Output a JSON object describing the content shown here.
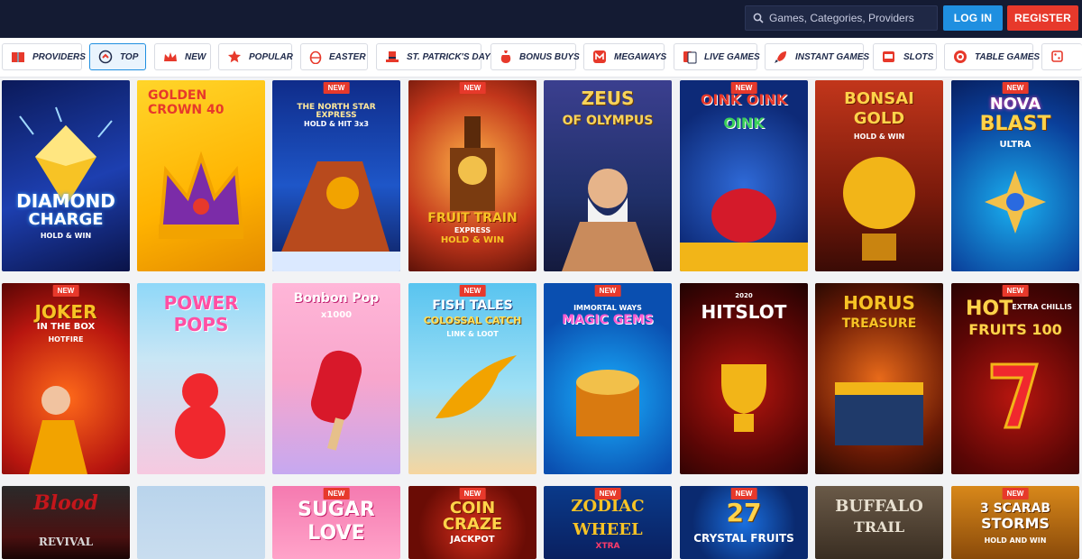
{
  "header": {
    "search_placeholder": "Games, Categories, Providers",
    "login_label": "LOG IN",
    "register_label": "REGISTER"
  },
  "categories": [
    {
      "label": "PROVIDERS",
      "icon": "book-icon"
    },
    {
      "label": "TOP",
      "icon": "top-arrow-icon",
      "active": true
    },
    {
      "label": "NEW",
      "icon": "crown-icon"
    },
    {
      "label": "POPULAR",
      "icon": "star-badge-icon"
    },
    {
      "label": "EASTER",
      "icon": "easter-egg-icon"
    },
    {
      "label": "ST. PATRICK'S DAY",
      "icon": "leprechaun-hat-icon"
    },
    {
      "label": "BONUS BUYS",
      "icon": "money-bag-icon"
    },
    {
      "label": "MEGAWAYS",
      "icon": "megaways-icon"
    },
    {
      "label": "LIVE GAMES",
      "icon": "playing-cards-icon"
    },
    {
      "label": "INSTANT GAMES",
      "icon": "rocket-icon"
    },
    {
      "label": "SLOTS",
      "icon": "slot-machine-icon"
    },
    {
      "label": "TABLE GAMES",
      "icon": "poker-chip-icon"
    },
    {
      "label": "",
      "icon": "dice-icon"
    }
  ],
  "new_badge": "NEW",
  "games": {
    "row1": [
      {
        "title": "DIAMOND",
        "title2": "CHARGE",
        "sub": "HOLD & WIN",
        "new": false
      },
      {
        "title": "GOLDEN",
        "title2": "CROWN 40",
        "sub": "",
        "new": false
      },
      {
        "title": "THE NORTH STAR EXPRESS",
        "title2": "",
        "sub": "HOLD & HIT 3x3",
        "new": true
      },
      {
        "title": "FRUIT TRAIN",
        "title2": "EXPRESS",
        "sub": "HOLD & WIN",
        "new": true
      },
      {
        "title": "ZEUS",
        "title2": "OF OLYMPUS",
        "sub": "",
        "new": false
      },
      {
        "title": "OINK OINK",
        "title2": "OINK",
        "sub": "",
        "new": true
      },
      {
        "title": "BONSAI",
        "title2": "GOLD",
        "sub": "HOLD & WIN",
        "new": false
      },
      {
        "title": "NOVA",
        "title2": "BLAST",
        "sub": "ULTRA",
        "new": true
      }
    ],
    "row2": [
      {
        "title": "JOKER",
        "title2": "IN THE BOX",
        "sub": "HOTFIRE",
        "new": true
      },
      {
        "title": "POWER",
        "title2": "POPS",
        "sub": "",
        "new": false
      },
      {
        "title": "Bonbon Pop",
        "title2": "x1000",
        "sub": "",
        "new": false
      },
      {
        "title": "FISH TALES",
        "title2": "COLOSSAL CATCH",
        "sub": "LINK & LOOT",
        "new": true
      },
      {
        "title": "IMMORTAL WAYS",
        "title2": "MAGIC GEMS",
        "sub": "",
        "new": true
      },
      {
        "title": "HITSLOT",
        "title2": "2020",
        "sub": "",
        "new": false
      },
      {
        "title": "HORUS",
        "title2": "TREASURE",
        "sub": "",
        "new": false
      },
      {
        "title": "HOT",
        "title2": "FRUITS 100",
        "sub": "EXTRA CHILLIS",
        "new": true
      }
    ],
    "row3": [
      {
        "title": "Blood",
        "title2": "REVIVAL",
        "sub": "",
        "new": false
      },
      {
        "title": "",
        "title2": "",
        "sub": "",
        "new": false
      },
      {
        "title": "SUGAR",
        "title2": "LOVE",
        "sub": "",
        "new": true
      },
      {
        "title": "COIN",
        "title2": "CRAZE",
        "sub": "JACKPOT",
        "new": true
      },
      {
        "title": "ZODIAC",
        "title2": "WHEEL",
        "sub": "XTRA",
        "new": true
      },
      {
        "title": "27",
        "title2": "CRYSTAL FRUITS",
        "sub": "",
        "new": true
      },
      {
        "title": "BUFFALO",
        "title2": "TRAIL",
        "sub": "",
        "new": false
      },
      {
        "title": "3 SCARAB",
        "title2": "STORMS",
        "sub": "HOLD AND WIN",
        "new": true
      }
    ]
  },
  "colors": {
    "topbar": "#141b33",
    "login": "#1f8fe0",
    "register": "#e7392b",
    "new_badge": "#e7392b"
  }
}
